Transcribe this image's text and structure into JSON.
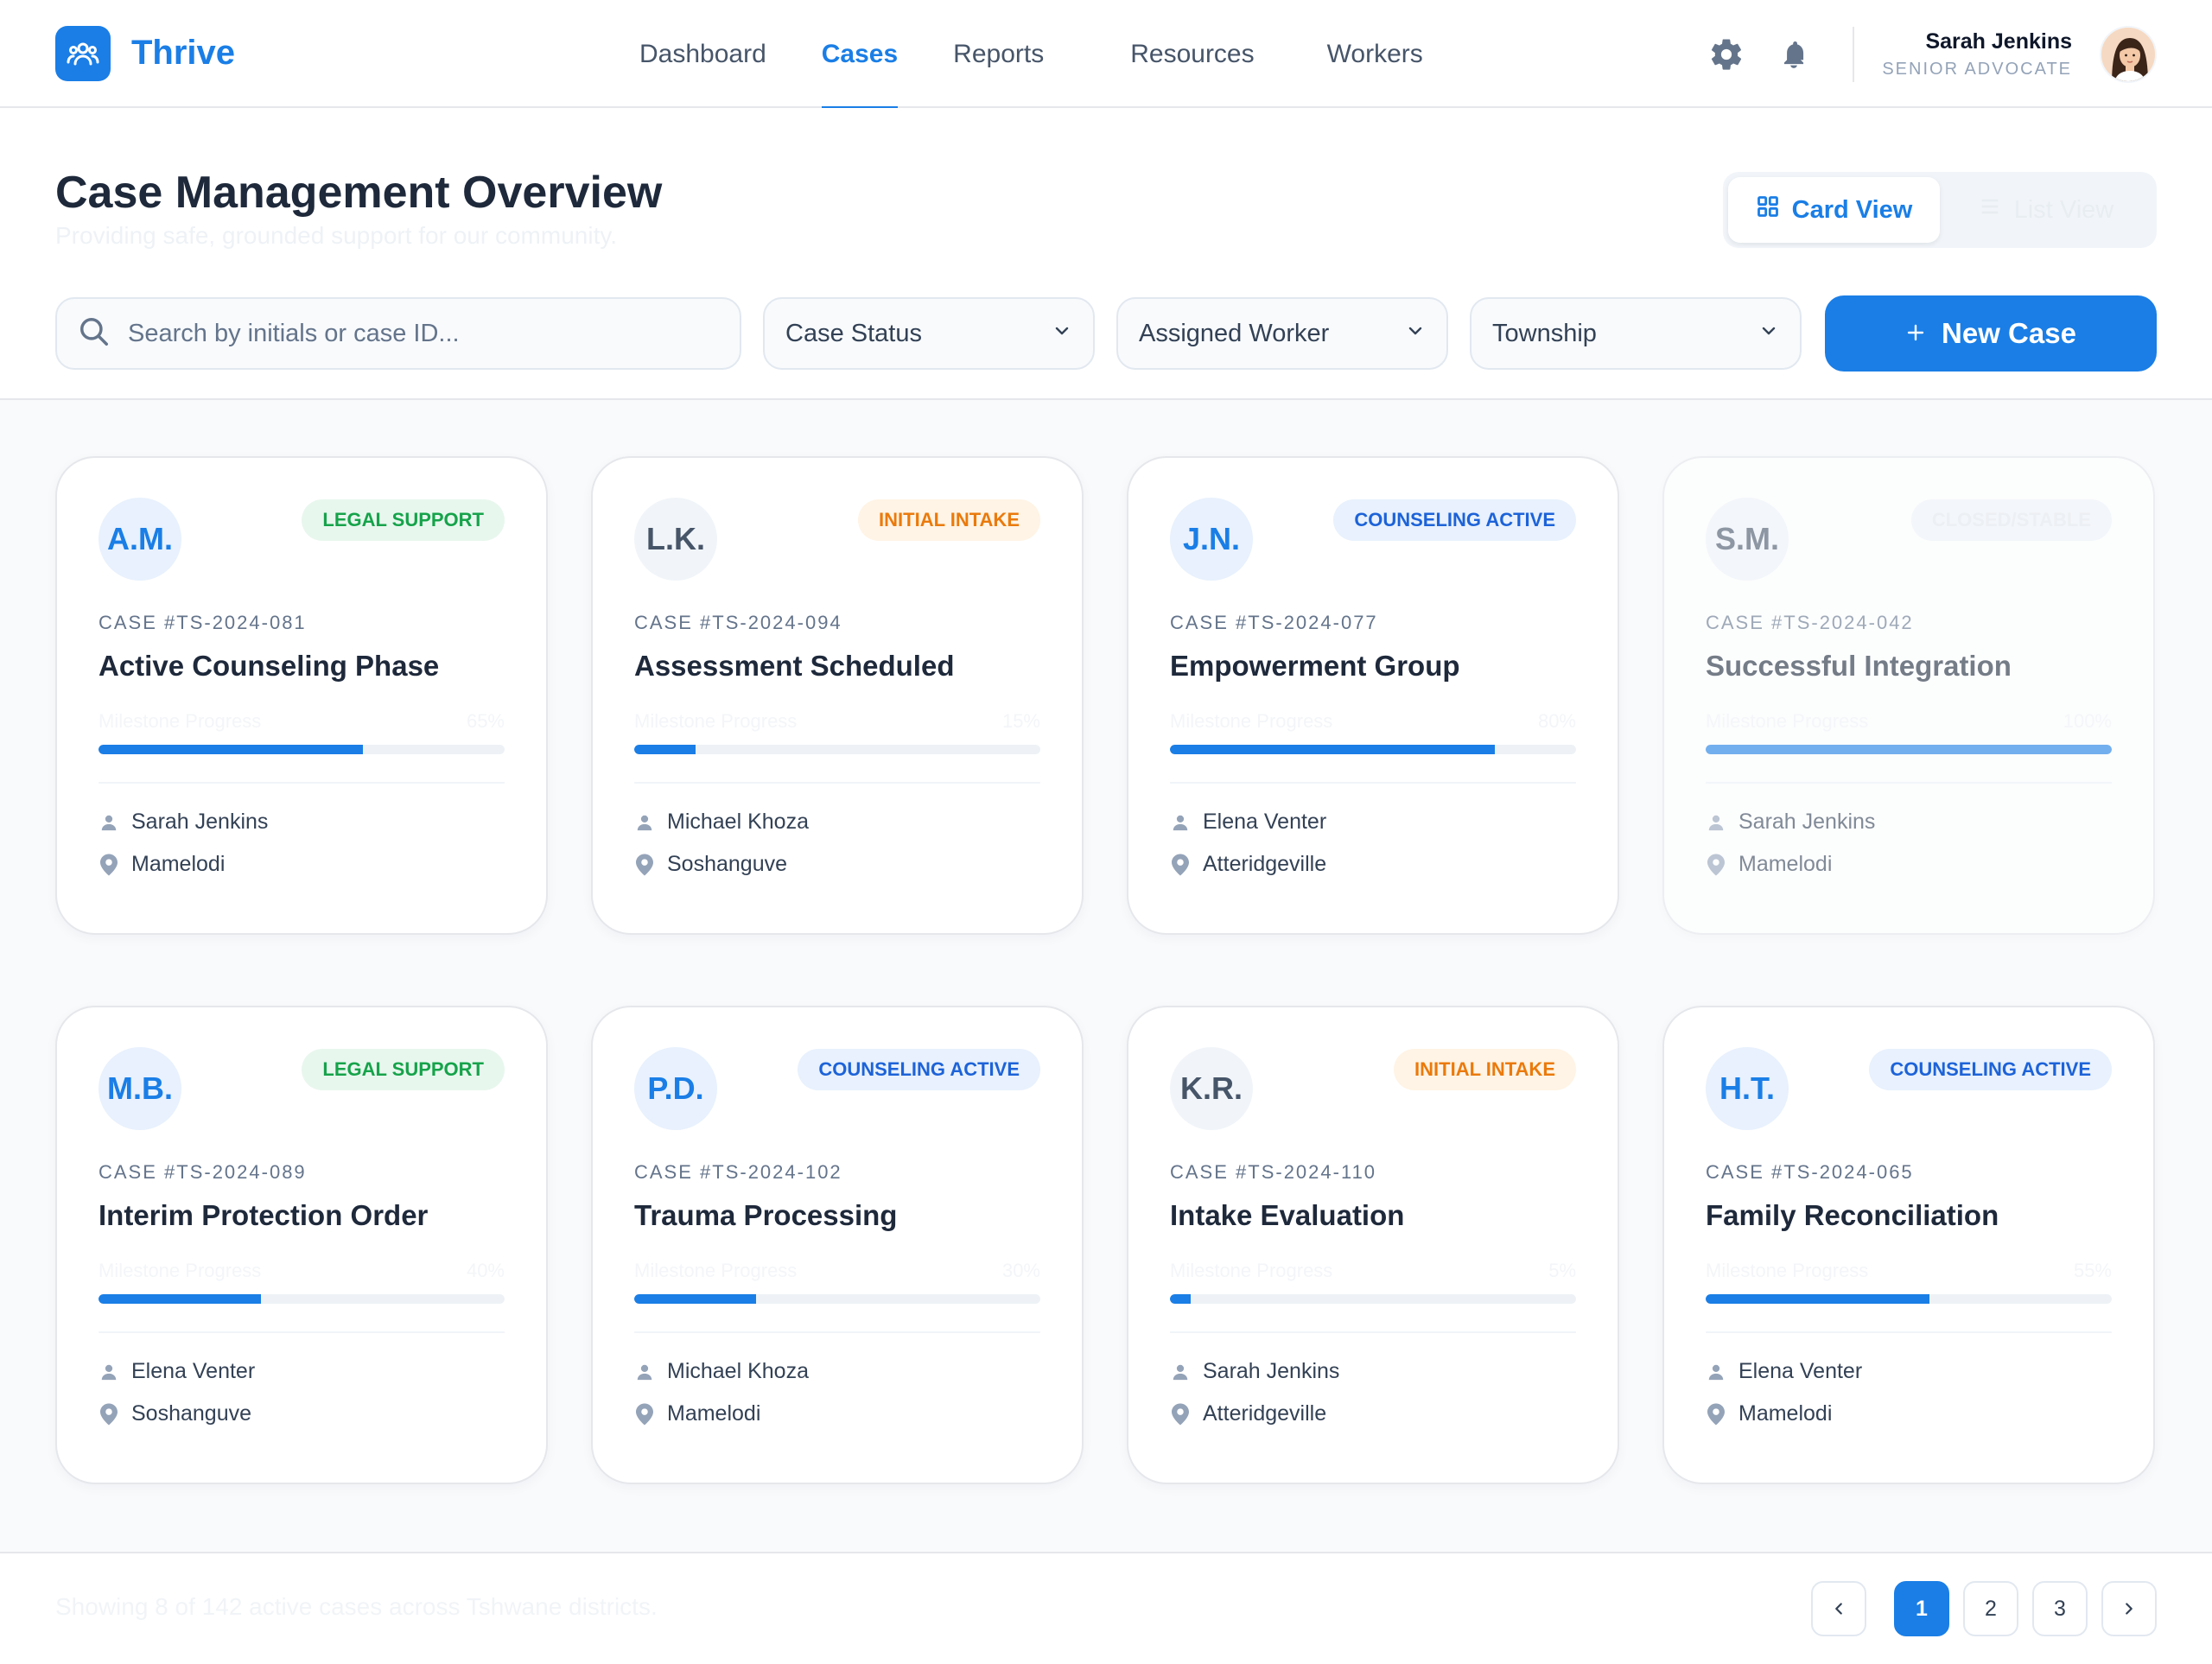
{
  "app": {
    "name": "Thrive"
  },
  "nav": {
    "items": [
      {
        "label": "Dashboard",
        "active": false
      },
      {
        "label": "Cases",
        "active": true
      },
      {
        "label": "Reports",
        "active": false
      },
      {
        "label": "Resources",
        "active": false
      },
      {
        "label": "Workers",
        "active": false
      }
    ]
  },
  "user": {
    "name": "Sarah Jenkins",
    "role": "SENIOR ADVOCATE"
  },
  "page": {
    "title": "Case Management Overview",
    "subtitle": "Providing safe, grounded support for our community."
  },
  "view_toggle": {
    "card_label": "Card View",
    "list_label": "List View"
  },
  "filters": {
    "search_placeholder": "Search by initials or case ID...",
    "status_label": "Case Status",
    "worker_label": "Assigned Worker",
    "township_label": "Township",
    "new_case_label": "New Case"
  },
  "cards": [
    {
      "initials": "A.M.",
      "initials_style": "blue",
      "badge": "LEGAL SUPPORT",
      "badge_style": "green",
      "case_id": "CASE #TS-2024-081",
      "title": "Active Counseling Phase",
      "progress_label": "Milestone Progress",
      "progress_text": "65%",
      "progress": 65,
      "worker": "Sarah Jenkins",
      "location": "Mamelodi",
      "dim": false
    },
    {
      "initials": "L.K.",
      "initials_style": "gray",
      "badge": "INITIAL INTAKE",
      "badge_style": "orange",
      "case_id": "CASE #TS-2024-094",
      "title": "Assessment Scheduled",
      "progress_label": "Milestone Progress",
      "progress_text": "15%",
      "progress": 15,
      "worker": "Michael Khoza",
      "location": "Soshanguve",
      "dim": false
    },
    {
      "initials": "J.N.",
      "initials_style": "blue",
      "badge": "COUNSELING ACTIVE",
      "badge_style": "blue",
      "case_id": "CASE #TS-2024-077",
      "title": "Empowerment Group",
      "progress_label": "Milestone Progress",
      "progress_text": "80%",
      "progress": 80,
      "worker": "Elena Venter",
      "location": "Atteridgeville",
      "dim": false
    },
    {
      "initials": "S.M.",
      "initials_style": "gray",
      "badge": "CLOSED/STABLE",
      "badge_style": "gray",
      "case_id": "CASE #TS-2024-042",
      "title": "Successful Integration",
      "progress_label": "Milestone Progress",
      "progress_text": "100%",
      "progress": 100,
      "worker": "Sarah Jenkins",
      "location": "Mamelodi",
      "dim": true
    },
    {
      "initials": "M.B.",
      "initials_style": "blue",
      "badge": "LEGAL SUPPORT",
      "badge_style": "green",
      "case_id": "CASE #TS-2024-089",
      "title": "Interim Protection Order",
      "progress_label": "Milestone Progress",
      "progress_text": "40%",
      "progress": 40,
      "worker": "Elena Venter",
      "location": "Soshanguve",
      "dim": false
    },
    {
      "initials": "P.D.",
      "initials_style": "blue",
      "badge": "COUNSELING ACTIVE",
      "badge_style": "blue",
      "case_id": "CASE #TS-2024-102",
      "title": "Trauma Processing",
      "progress_label": "Milestone Progress",
      "progress_text": "30%",
      "progress": 30,
      "worker": "Michael Khoza",
      "location": "Mamelodi",
      "dim": false
    },
    {
      "initials": "K.R.",
      "initials_style": "gray",
      "badge": "INITIAL INTAKE",
      "badge_style": "orange",
      "case_id": "CASE #TS-2024-110",
      "title": "Intake Evaluation",
      "progress_label": "Milestone Progress",
      "progress_text": "5%",
      "progress": 5,
      "worker": "Sarah Jenkins",
      "location": "Atteridgeville",
      "dim": false
    },
    {
      "initials": "H.T.",
      "initials_style": "blue",
      "badge": "COUNSELING ACTIVE",
      "badge_style": "blue",
      "case_id": "CASE #TS-2024-065",
      "title": "Family Reconciliation",
      "progress_label": "Milestone Progress",
      "progress_text": "55%",
      "progress": 55,
      "worker": "Elena Venter",
      "location": "Mamelodi",
      "dim": false
    }
  ],
  "footer": {
    "summary": "Showing 8 of 142 active cases across Tshwane districts.",
    "pages": [
      "1",
      "2",
      "3"
    ],
    "current_page": "1"
  },
  "colors": {
    "accent": "#1a7ee6",
    "green": "#16a34a",
    "orange": "#ea7a0c"
  }
}
